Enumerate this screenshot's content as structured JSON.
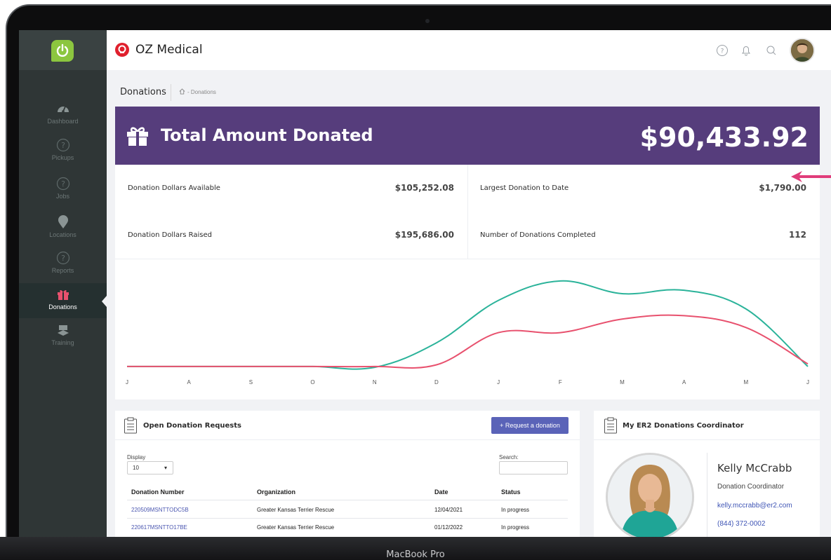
{
  "device": {
    "label": "MacBook Pro"
  },
  "sidebar": {
    "items": [
      {
        "label": "Dashboard",
        "icon": "dashboard-gauge-icon"
      },
      {
        "label": "Pickups",
        "icon": "help-circle-icon"
      },
      {
        "label": "Jobs",
        "icon": "help-circle-icon"
      },
      {
        "label": "Locations",
        "icon": "map-pin-icon"
      },
      {
        "label": "Reports",
        "icon": "help-circle-icon"
      },
      {
        "label": "Donations",
        "icon": "gift-icon",
        "active": true
      },
      {
        "label": "Training",
        "icon": "graduation-cap-icon"
      }
    ]
  },
  "topbar": {
    "brand": "OZ Medical",
    "icons": [
      "help-icon",
      "bell-icon",
      "search-icon",
      "user-avatar"
    ]
  },
  "page": {
    "title": "Donations",
    "breadcrumb": "- Donations"
  },
  "banner": {
    "title": "Total Amount Donated",
    "amount": "$90,433.92",
    "color": "#563d7c"
  },
  "stats": {
    "available_label": "Donation Dollars Available",
    "available_value": "$105,252.08",
    "raised_label": "Donation Dollars Raised",
    "raised_value": "$195,686.00",
    "largest_label": "Largest Donation to Date",
    "largest_value": "$1,790.00",
    "count_label": "Number of Donations Completed",
    "count_value": "112"
  },
  "chart_data": {
    "type": "line",
    "categories": [
      "J",
      "A",
      "S",
      "O",
      "N",
      "D",
      "J",
      "F",
      "M",
      "A",
      "M",
      "J"
    ],
    "series": [
      {
        "color": "#2bb39a",
        "values": [
          0,
          0,
          0,
          0,
          -1,
          28,
          78,
          101,
          86,
          90,
          68,
          0
        ]
      },
      {
        "color": "#e8516e",
        "values": [
          0,
          0,
          0,
          0,
          0,
          2,
          40,
          40,
          56,
          60,
          46,
          3
        ]
      }
    ],
    "ylim": [
      -10,
      110
    ],
    "grid": false
  },
  "requests": {
    "title": "Open Donation Requests",
    "button": "+ Request a donation",
    "display_label": "Display",
    "display_value": "10",
    "search_label": "Search:",
    "columns": [
      "Donation Number",
      "Organization",
      "Date",
      "Status"
    ],
    "rows": [
      [
        "220509MSNTTODC5B",
        "Greater Kansas Terrier Rescue",
        "12/04/2021",
        "In progress"
      ],
      [
        "220617MSNTTO17BE",
        "Greater Kansas Terrier Rescue",
        "01/12/2022",
        "In progress"
      ]
    ]
  },
  "coordinator": {
    "title": "My ER2 Donations Coordinator",
    "name": "Kelly McCrabb",
    "role": "Donation Coordinator",
    "email": "kelly.mccrabb@er2.com",
    "phone": "(844) 372-0002"
  }
}
